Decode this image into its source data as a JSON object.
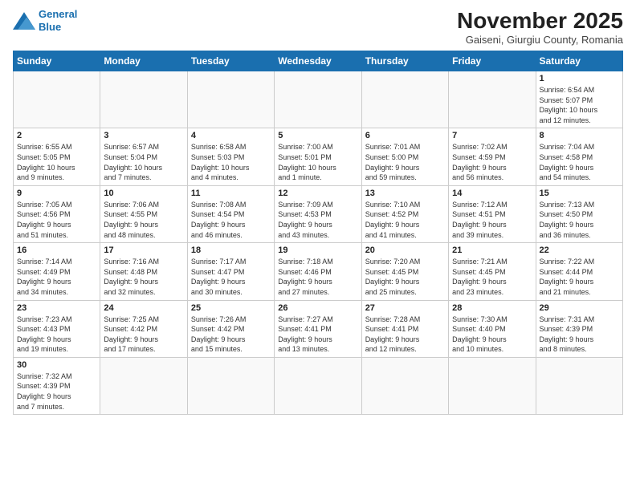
{
  "header": {
    "logo_line1": "General",
    "logo_line2": "Blue",
    "month_title": "November 2025",
    "subtitle": "Gaiseni, Giurgiu County, Romania"
  },
  "weekdays": [
    "Sunday",
    "Monday",
    "Tuesday",
    "Wednesday",
    "Thursday",
    "Friday",
    "Saturday"
  ],
  "weeks": [
    [
      {
        "day": "",
        "info": ""
      },
      {
        "day": "",
        "info": ""
      },
      {
        "day": "",
        "info": ""
      },
      {
        "day": "",
        "info": ""
      },
      {
        "day": "",
        "info": ""
      },
      {
        "day": "",
        "info": ""
      },
      {
        "day": "1",
        "info": "Sunrise: 6:54 AM\nSunset: 5:07 PM\nDaylight: 10 hours\nand 12 minutes."
      }
    ],
    [
      {
        "day": "2",
        "info": "Sunrise: 6:55 AM\nSunset: 5:05 PM\nDaylight: 10 hours\nand 9 minutes."
      },
      {
        "day": "3",
        "info": "Sunrise: 6:57 AM\nSunset: 5:04 PM\nDaylight: 10 hours\nand 7 minutes."
      },
      {
        "day": "4",
        "info": "Sunrise: 6:58 AM\nSunset: 5:03 PM\nDaylight: 10 hours\nand 4 minutes."
      },
      {
        "day": "5",
        "info": "Sunrise: 7:00 AM\nSunset: 5:01 PM\nDaylight: 10 hours\nand 1 minute."
      },
      {
        "day": "6",
        "info": "Sunrise: 7:01 AM\nSunset: 5:00 PM\nDaylight: 9 hours\nand 59 minutes."
      },
      {
        "day": "7",
        "info": "Sunrise: 7:02 AM\nSunset: 4:59 PM\nDaylight: 9 hours\nand 56 minutes."
      },
      {
        "day": "8",
        "info": "Sunrise: 7:04 AM\nSunset: 4:58 PM\nDaylight: 9 hours\nand 54 minutes."
      }
    ],
    [
      {
        "day": "9",
        "info": "Sunrise: 7:05 AM\nSunset: 4:56 PM\nDaylight: 9 hours\nand 51 minutes."
      },
      {
        "day": "10",
        "info": "Sunrise: 7:06 AM\nSunset: 4:55 PM\nDaylight: 9 hours\nand 48 minutes."
      },
      {
        "day": "11",
        "info": "Sunrise: 7:08 AM\nSunset: 4:54 PM\nDaylight: 9 hours\nand 46 minutes."
      },
      {
        "day": "12",
        "info": "Sunrise: 7:09 AM\nSunset: 4:53 PM\nDaylight: 9 hours\nand 43 minutes."
      },
      {
        "day": "13",
        "info": "Sunrise: 7:10 AM\nSunset: 4:52 PM\nDaylight: 9 hours\nand 41 minutes."
      },
      {
        "day": "14",
        "info": "Sunrise: 7:12 AM\nSunset: 4:51 PM\nDaylight: 9 hours\nand 39 minutes."
      },
      {
        "day": "15",
        "info": "Sunrise: 7:13 AM\nSunset: 4:50 PM\nDaylight: 9 hours\nand 36 minutes."
      }
    ],
    [
      {
        "day": "16",
        "info": "Sunrise: 7:14 AM\nSunset: 4:49 PM\nDaylight: 9 hours\nand 34 minutes."
      },
      {
        "day": "17",
        "info": "Sunrise: 7:16 AM\nSunset: 4:48 PM\nDaylight: 9 hours\nand 32 minutes."
      },
      {
        "day": "18",
        "info": "Sunrise: 7:17 AM\nSunset: 4:47 PM\nDaylight: 9 hours\nand 30 minutes."
      },
      {
        "day": "19",
        "info": "Sunrise: 7:18 AM\nSunset: 4:46 PM\nDaylight: 9 hours\nand 27 minutes."
      },
      {
        "day": "20",
        "info": "Sunrise: 7:20 AM\nSunset: 4:45 PM\nDaylight: 9 hours\nand 25 minutes."
      },
      {
        "day": "21",
        "info": "Sunrise: 7:21 AM\nSunset: 4:45 PM\nDaylight: 9 hours\nand 23 minutes."
      },
      {
        "day": "22",
        "info": "Sunrise: 7:22 AM\nSunset: 4:44 PM\nDaylight: 9 hours\nand 21 minutes."
      }
    ],
    [
      {
        "day": "23",
        "info": "Sunrise: 7:23 AM\nSunset: 4:43 PM\nDaylight: 9 hours\nand 19 minutes."
      },
      {
        "day": "24",
        "info": "Sunrise: 7:25 AM\nSunset: 4:42 PM\nDaylight: 9 hours\nand 17 minutes."
      },
      {
        "day": "25",
        "info": "Sunrise: 7:26 AM\nSunset: 4:42 PM\nDaylight: 9 hours\nand 15 minutes."
      },
      {
        "day": "26",
        "info": "Sunrise: 7:27 AM\nSunset: 4:41 PM\nDaylight: 9 hours\nand 13 minutes."
      },
      {
        "day": "27",
        "info": "Sunrise: 7:28 AM\nSunset: 4:41 PM\nDaylight: 9 hours\nand 12 minutes."
      },
      {
        "day": "28",
        "info": "Sunrise: 7:30 AM\nSunset: 4:40 PM\nDaylight: 9 hours\nand 10 minutes."
      },
      {
        "day": "29",
        "info": "Sunrise: 7:31 AM\nSunset: 4:39 PM\nDaylight: 9 hours\nand 8 minutes."
      }
    ],
    [
      {
        "day": "30",
        "info": "Sunrise: 7:32 AM\nSunset: 4:39 PM\nDaylight: 9 hours\nand 7 minutes."
      },
      {
        "day": "",
        "info": ""
      },
      {
        "day": "",
        "info": ""
      },
      {
        "day": "",
        "info": ""
      },
      {
        "day": "",
        "info": ""
      },
      {
        "day": "",
        "info": ""
      },
      {
        "day": "",
        "info": ""
      }
    ]
  ]
}
